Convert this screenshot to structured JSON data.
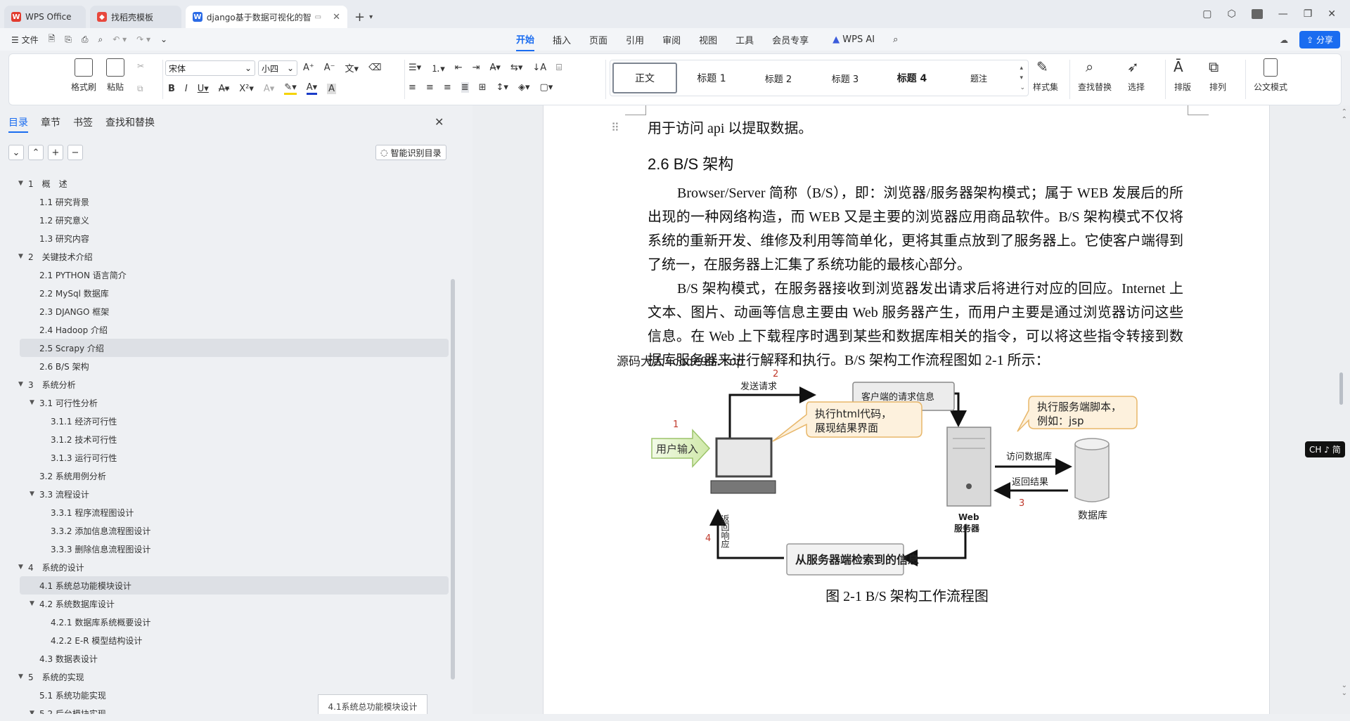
{
  "titlebar": {
    "tabs": [
      {
        "label": "WPS Office",
        "icon": "wps-logo-icon"
      },
      {
        "label": "找稻壳模板",
        "icon": "docer-icon"
      },
      {
        "label": "django基于数据可视化的智",
        "icon": "word-doc-icon"
      }
    ]
  },
  "menubar": {
    "file_label": "文件",
    "tabs": [
      "开始",
      "插入",
      "页面",
      "引用",
      "审阅",
      "视图",
      "工具",
      "会员专享"
    ],
    "active_tab": "开始",
    "ai_label": "WPS AI",
    "share_label": "分享"
  },
  "ribbon": {
    "format_painter": "格式刷",
    "paste": "粘贴",
    "font_name": "宋体",
    "font_size": "小四",
    "styles": [
      "正文",
      "标题 1",
      "标题 2",
      "标题 3",
      "标题 4",
      "题注"
    ],
    "style_set": "样式集",
    "find_replace": "查找替换",
    "select": "选择",
    "layout": "排版",
    "arrange": "排列",
    "official_mode": "公文模式"
  },
  "left_panel": {
    "tabs": [
      "目录",
      "章节",
      "书签",
      "查找和替换"
    ],
    "smart_toc_label": "智能识别目录",
    "toc": [
      {
        "label": "1　概　述",
        "level": 1,
        "expanded": true
      },
      {
        "label": "1.1 研究背景",
        "level": 2
      },
      {
        "label": "1.2 研究意义",
        "level": 2
      },
      {
        "label": "1.3 研究内容",
        "level": 2
      },
      {
        "label": "2　关键技术介绍",
        "level": 1,
        "expanded": true
      },
      {
        "label": "2.1 PYTHON 语言简介",
        "level": 2
      },
      {
        "label": "2.2 MySql 数据库",
        "level": 2
      },
      {
        "label": "2.3 DJANGO 框架",
        "level": 2
      },
      {
        "label": "2.4 Hadoop 介绍",
        "level": 2
      },
      {
        "label": "2.5 Scrapy 介绍",
        "level": 2,
        "highlighted": true
      },
      {
        "label": "2.6 B/S 架构",
        "level": 2
      },
      {
        "label": "3　系统分析",
        "level": 1,
        "expanded": true
      },
      {
        "label": "3.1 可行性分析",
        "level": 2,
        "expanded": true
      },
      {
        "label": "3.1.1 经济可行性",
        "level": 3
      },
      {
        "label": "3.1.2 技术可行性",
        "level": 3
      },
      {
        "label": "3.1.3 运行可行性",
        "level": 3
      },
      {
        "label": "3.2 系统用例分析",
        "level": 2
      },
      {
        "label": "3.3 流程设计",
        "level": 2,
        "expanded": true
      },
      {
        "label": "3.3.1 程序流程图设计",
        "level": 3
      },
      {
        "label": "3.3.2 添加信息流程图设计",
        "level": 3
      },
      {
        "label": "3.3.3 删除信息流程图设计",
        "level": 3
      },
      {
        "label": "4　系统的设计",
        "level": 1,
        "expanded": true
      },
      {
        "label": "4.1 系统总功能模块设计",
        "level": 2,
        "highlighted": true
      },
      {
        "label": "4.2 系统数据库设计",
        "level": 2,
        "expanded": true
      },
      {
        "label": "4.2.1 数据库系统概要设计",
        "level": 3
      },
      {
        "label": "4.2.2 E-R 模型结构设计",
        "level": 3
      },
      {
        "label": "4.3 数据表设计",
        "level": 2
      },
      {
        "label": "5　系统的实现",
        "level": 1,
        "expanded": true
      },
      {
        "label": "5.1 系统功能实现",
        "level": 2
      },
      {
        "label": "5.2 后台模块实现",
        "level": 2,
        "expanded": true
      }
    ],
    "tooltip": "4.1系统总功能模块设计"
  },
  "document": {
    "top_line": "用于访问 api 以提取数据。",
    "heading": "2.6 B/S 架构",
    "para1": "Browser/Server 简称（B/S），即：浏览器/服务器架构模式；属于 WEB 发展后的所出现的一种网络构造，而 WEB 又是主要的浏览器应用商品软件。B/S 架构模式不仅将系统的重新开发、维修及利用等简单化，更将其重点放到了服务器上。它使客户端得到了统一，在服务器上汇集了系统功能的最核心部分。",
    "para2": "B/S 架构模式，在服务器接收到浏览器发出请求后将进行对应的回应。Internet 上文本、图片、动画等信息主要由 Web 服务器产生，而用户主要是通过浏览器访问这些信息。在 Web 上下载程序时遇到某些和数据库相关的指令，可以将这些指令转接到数据库服务器来进行解释和执行。B/S 架构工作流程图如 2-1 所示：",
    "watermark": "源码大大-code99.top",
    "caption": "图 2-1 B/S 架构工作流程图",
    "diagram": {
      "user_input": "用户输入",
      "send_request": "发送请求",
      "client_request": "客户端的请求信息",
      "exec_html": "执行html代码，",
      "show_result": "展现结果界面",
      "exec_server": "执行服务端脚本，",
      "example": "例如：jsp",
      "access_db": "访问数据库",
      "return_result": "返回结果",
      "web_server_1": "Web",
      "web_server_2": "服务器",
      "database": "数据库",
      "return_resp": "返回响应",
      "retrieved": "从服务器端检索到的信息",
      "step1": "1",
      "step2": "2",
      "step3": "3",
      "step4": "4"
    }
  },
  "ime_badge": "CH ♪ 简",
  "colors": {
    "accent": "#1a6cf0",
    "highlight": "#dde0e5"
  }
}
